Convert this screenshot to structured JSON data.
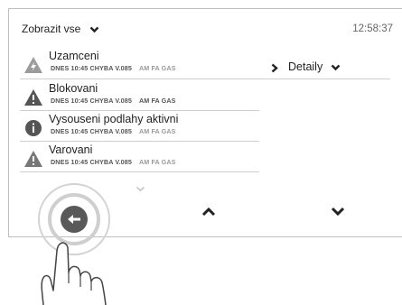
{
  "header": {
    "filter_label": "Zobrazit vse",
    "time": "12:58:37"
  },
  "selected_item": {
    "title": "Uzamceni",
    "meta": "DNES 10:45 CHYBA V.085",
    "source": "AM FA GAS",
    "icon": "lightning-warning-icon",
    "details_label": "Detaily"
  },
  "items": [
    {
      "title": "Blokovani",
      "meta": "DNES 10:45 CHYBA V.085",
      "source": "AM FA GAS",
      "icon": "warning-icon"
    },
    {
      "title": "Vysouseni podlahy aktivni",
      "meta": "DNES 10:45 CHYBA V.085",
      "source": "AM FA GAS",
      "icon": "info-icon"
    },
    {
      "title": "Varovani",
      "meta": "DNES 10:45 CHYBA V.085",
      "source": "AM FA GAS",
      "icon": "warning-icon"
    }
  ],
  "nav": {
    "back_icon": "back-arrow-icon",
    "up_icon": "chevron-up-icon",
    "down_icon": "chevron-down-icon",
    "more_icon": "chevron-down-icon"
  },
  "colors": {
    "accent": "#595959",
    "divider": "#cfcfcf",
    "muted_text": "#9a9a9a"
  }
}
